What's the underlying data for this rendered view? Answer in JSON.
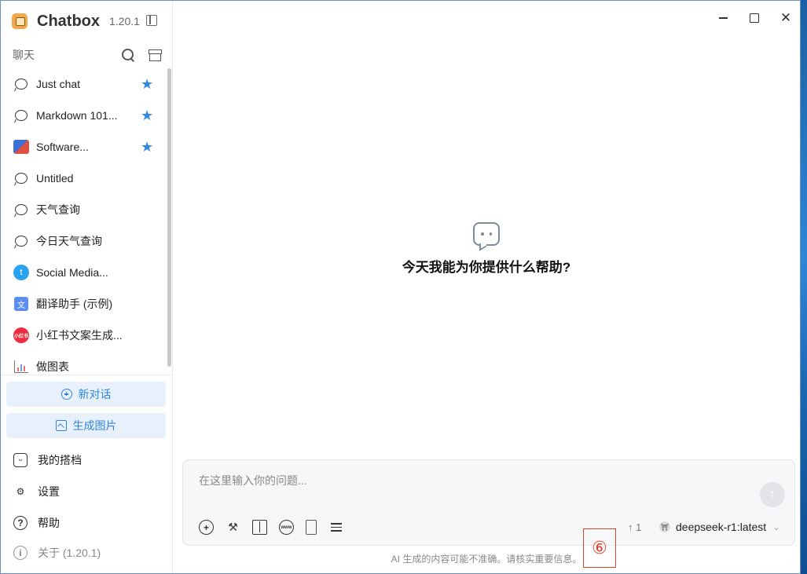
{
  "app": {
    "name": "Chatbox",
    "version": "1.20.1"
  },
  "sidebar": {
    "section_title": "聊天",
    "items": [
      {
        "label": "Just chat",
        "icon": "chat-bubble-icon",
        "starred": true
      },
      {
        "label": "Markdown 101...",
        "icon": "chat-bubble-icon",
        "starred": true
      },
      {
        "label": "Software...",
        "icon": "software-dev-avatar",
        "starred": true
      },
      {
        "label": "Untitled",
        "icon": "chat-bubble-icon",
        "starred": false
      },
      {
        "label": "天气查询",
        "icon": "chat-bubble-icon",
        "starred": false
      },
      {
        "label": "今日天气查询",
        "icon": "chat-bubble-icon",
        "starred": false
      },
      {
        "label": "Social Media...",
        "icon": "twitter-avatar",
        "starred": false
      },
      {
        "label": "翻译助手 (示例)",
        "icon": "translate-avatar",
        "starred": false
      },
      {
        "label": "小红书文案生成...",
        "icon": "xiaohongshu-avatar",
        "starred": false
      },
      {
        "label": "做图表",
        "icon": "chart-avatar",
        "starred": false
      }
    ],
    "new_chat_label": "新对话",
    "image_gen_label": "生成图片",
    "bottom": {
      "partners": "我的搭档",
      "settings": "设置",
      "help": "帮助",
      "about": "关于 (1.20.1)"
    },
    "xhs_avatar_text": "小红书",
    "tw_avatar_text": "t",
    "tr_avatar_text": "文"
  },
  "main": {
    "empty_title": "今天我能为你提供什么帮助?",
    "composer": {
      "placeholder": "在这里输入你的问题...",
      "counter": "↑ 1",
      "model": "deepseek-r1:latest"
    },
    "disclaimer": "AI 生成的内容可能不准确。请核实重要信息。"
  },
  "annotation": {
    "badge": "⑥"
  }
}
